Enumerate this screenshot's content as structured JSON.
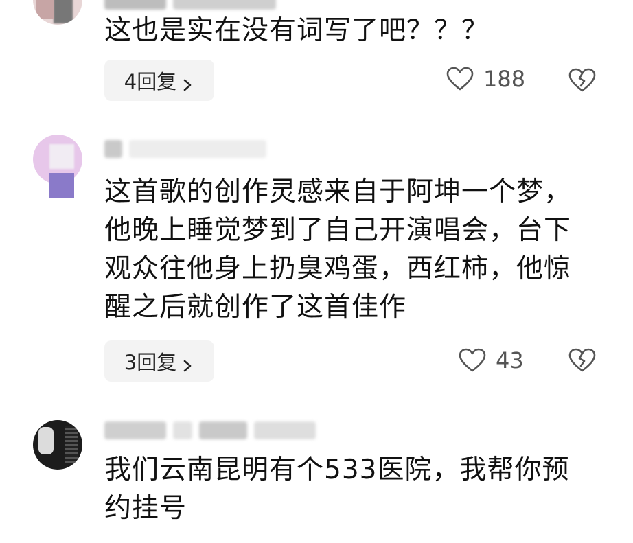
{
  "comments": [
    {
      "text": "这也是实在没有词写了吧？？？",
      "reply_label": "4回复",
      "likes": "188"
    },
    {
      "text": "这首歌的创作灵感来自于阿坤一个梦，\n他晚上睡觉梦到了自己开演唱会，台下\n观众往他身上扔臭鸡蛋，西红柿，他惊\n醒之后就创作了这首佳作",
      "reply_label": "3回复",
      "likes": "43"
    },
    {
      "text": "我们云南昆明有个533医院，我帮你预\n约挂号"
    }
  ],
  "icons": {
    "like": "heart-outline-icon",
    "dislike": "broken-heart-icon",
    "reply_arrow": "chevron-right-icon"
  },
  "colors": {
    "text": "#111111",
    "meta": "#555555",
    "reply_bg": "#f3f3f3"
  }
}
